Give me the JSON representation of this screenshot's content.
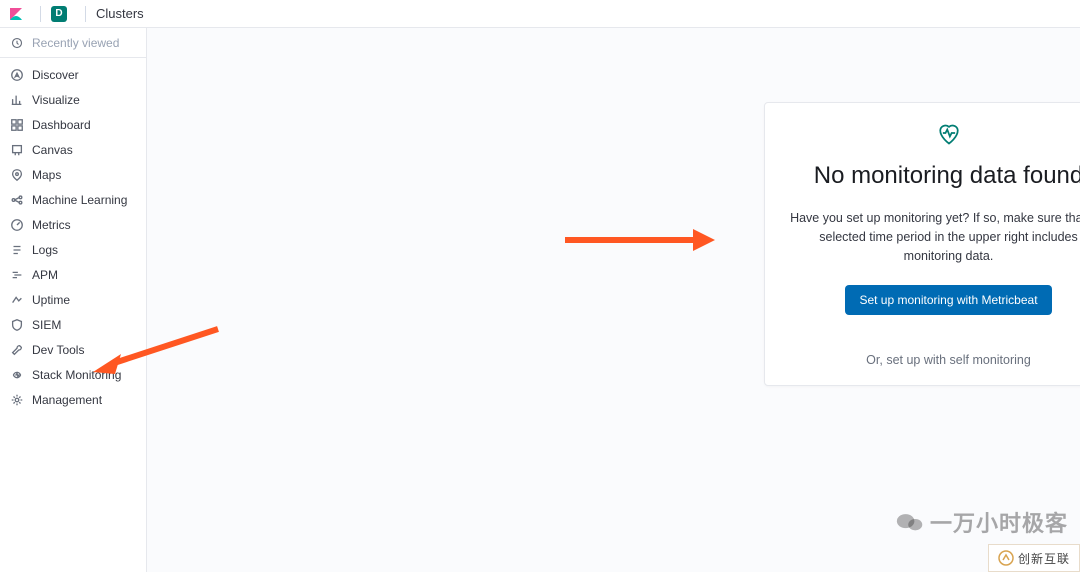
{
  "header": {
    "space_initial": "D",
    "breadcrumb": "Clusters"
  },
  "sidebar": {
    "recently_viewed": "Recently viewed",
    "items": [
      {
        "label": "Discover"
      },
      {
        "label": "Visualize"
      },
      {
        "label": "Dashboard"
      },
      {
        "label": "Canvas"
      },
      {
        "label": "Maps"
      },
      {
        "label": "Machine Learning"
      },
      {
        "label": "Metrics"
      },
      {
        "label": "Logs"
      },
      {
        "label": "APM"
      },
      {
        "label": "Uptime"
      },
      {
        "label": "SIEM"
      },
      {
        "label": "Dev Tools"
      },
      {
        "label": "Stack Monitoring"
      },
      {
        "label": "Management"
      }
    ]
  },
  "card": {
    "title": "No monitoring data found",
    "description": "Have you set up monitoring yet? If so, make sure that the selected time period in the upper right includes monitoring data.",
    "primary_button": "Set up monitoring with Metricbeat",
    "secondary_link": "Or, set up with self monitoring"
  },
  "watermark": {
    "text": "一万小时极客",
    "brand": "创新互联"
  }
}
